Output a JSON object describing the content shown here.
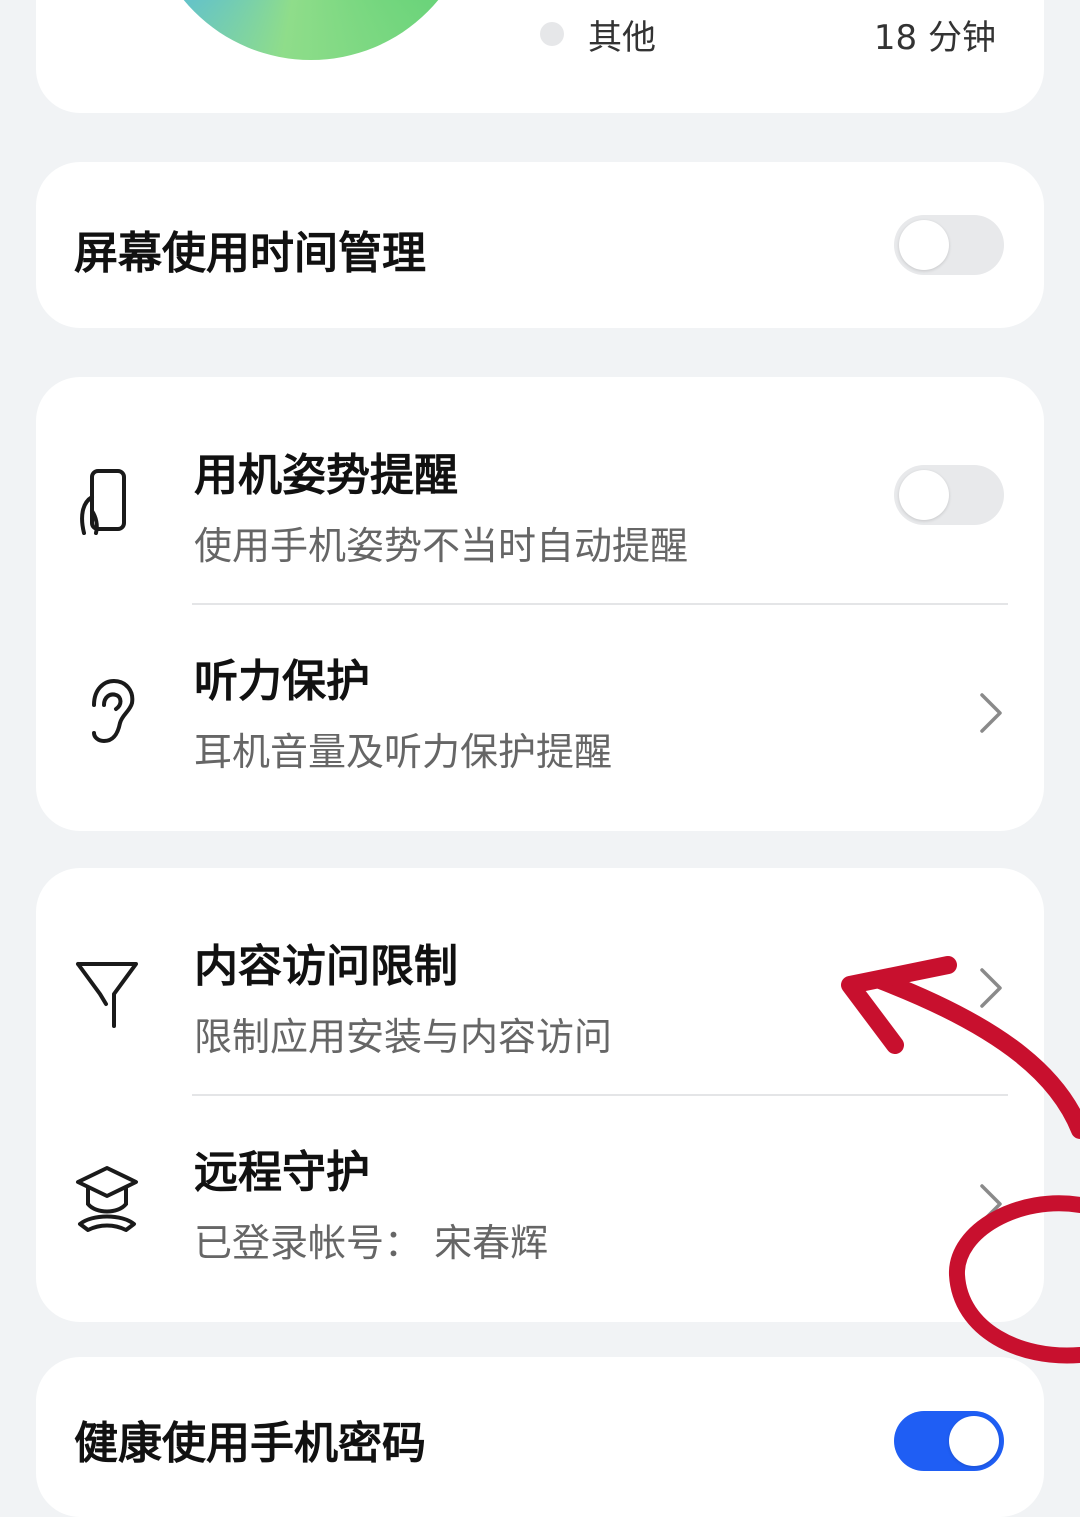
{
  "usage_summary": {
    "legend_other_label": "其他",
    "legend_other_value": "18 分钟"
  },
  "screen_time": {
    "title": "屏幕使用时间管理",
    "toggle_on": false
  },
  "health": {
    "posture": {
      "title": "用机姿势提醒",
      "subtitle": "使用手机姿势不当时自动提醒",
      "toggle_on": false,
      "icon": "phone-hand-icon"
    },
    "hearing": {
      "title": "听力保护",
      "subtitle": "耳机音量及听力保护提醒",
      "icon": "ear-icon"
    }
  },
  "content": {
    "restriction": {
      "title": "内容访问限制",
      "subtitle": "限制应用安装与内容访问",
      "icon": "filter-icon"
    },
    "remote": {
      "title": "远程守护",
      "subtitle": "已登录帐号：  宋春辉",
      "icon": "graduation-cap-icon"
    }
  },
  "healthy_password": {
    "title": "健康使用手机密码",
    "toggle_on": true
  },
  "colors": {
    "accent": "#1f5ef4",
    "annotation": "#c8102e"
  }
}
